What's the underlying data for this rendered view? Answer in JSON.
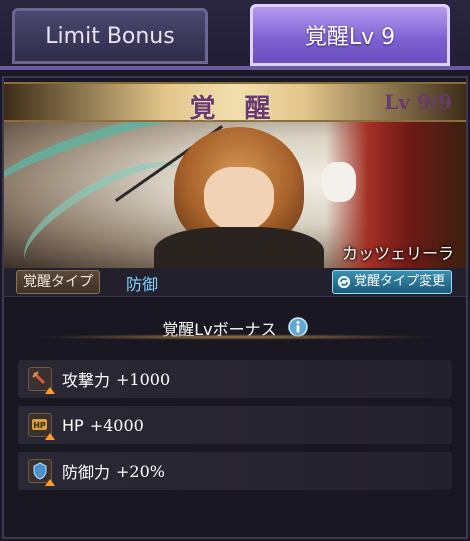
{
  "tabs": [
    {
      "label": "Limit Bonus",
      "active": false
    },
    {
      "label": "覚醒Lv 9",
      "active": true
    }
  ],
  "panel": {
    "title": "覚 醒",
    "level": "Lv 9/9"
  },
  "character": {
    "name": "カッツェリーラ"
  },
  "awakening_type": {
    "label": "覚醒タイプ",
    "value": "防御",
    "change_button": "覚醒タイプ変更",
    "change_icon": "refresh-icon"
  },
  "bonus": {
    "title": "覚醒Lvボーナス",
    "info_icon": "info-icon",
    "items": [
      {
        "icon": "attack-icon",
        "name": "攻撃力",
        "value": "+1000"
      },
      {
        "icon": "hp-icon",
        "name": "HP",
        "value": "+4000"
      },
      {
        "icon": "defense-icon",
        "name": "防御力",
        "value": "+20%"
      }
    ]
  },
  "colors": {
    "accent_active_tab": "#8d6fe0",
    "title_text": "#6a3a6d",
    "type_value": "#7ed4ff",
    "arrow": "#ff9d2a"
  }
}
